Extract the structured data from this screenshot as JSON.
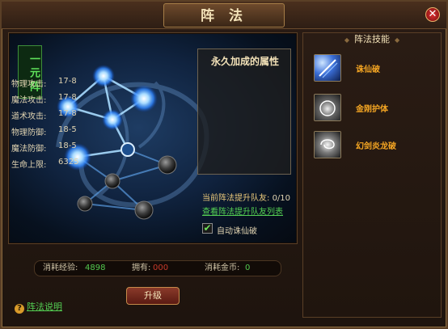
{
  "window": {
    "title": "阵 法",
    "close_icon": "✕"
  },
  "formation": {
    "banner": "一元阵"
  },
  "props": {
    "title": "永久加成的属性",
    "rows": [
      {
        "label": "物理攻击:",
        "value": "17-8"
      },
      {
        "label": "魔法攻击:",
        "value": "17-8"
      },
      {
        "label": "道术攻击:",
        "value": "17-8"
      },
      {
        "label": "物理防御:",
        "value": "18-5"
      },
      {
        "label": "魔法防御:",
        "value": "18-5"
      },
      {
        "label": "生命上限:",
        "value": "6325"
      }
    ]
  },
  "team": {
    "label": "当前阵法提升队友:",
    "value": "0/10",
    "link": "查看阵法提升队友列表",
    "auto_label": "自动诛仙破",
    "auto_checked": true
  },
  "cost": {
    "exp_label": "消耗经验:",
    "exp_value": "4898",
    "own_label": "拥有:",
    "own_value": "000",
    "gold_label": "消耗金币:",
    "gold_value": "0"
  },
  "upgrade_label": "升级",
  "help_label": "阵法说明",
  "skills": {
    "title": "阵法技能",
    "items": [
      {
        "name": "诛仙破",
        "icon": "sword-burst-icon"
      },
      {
        "name": "金刚护体",
        "icon": "shield-aura-icon"
      },
      {
        "name": "幻剑炎龙破",
        "icon": "vortex-icon"
      }
    ]
  }
}
